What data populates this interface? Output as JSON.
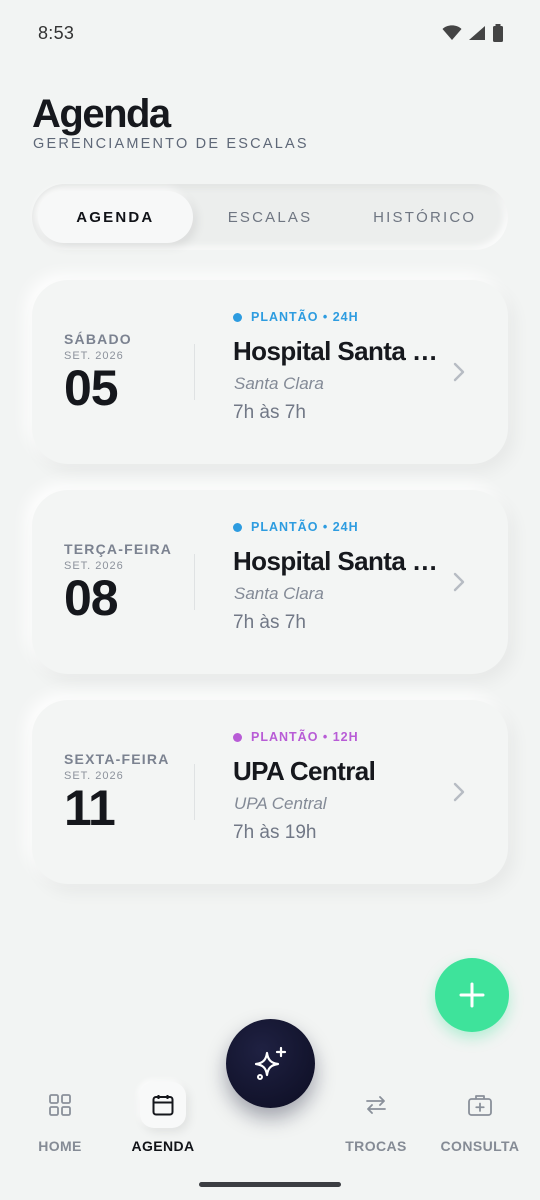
{
  "status": {
    "time": "8:53"
  },
  "header": {
    "title": "Agenda",
    "subtitle": "GERENCIAMENTO DE ESCALAS"
  },
  "tabs": [
    {
      "label": "AGENDA",
      "active": true
    },
    {
      "label": "ESCALAS",
      "active": false
    },
    {
      "label": "HISTÓRICO",
      "active": false
    }
  ],
  "cards": [
    {
      "weekday": "SÁBADO",
      "month": "SET. 2026",
      "day": "05",
      "shift": "PLANTÃO • 24H",
      "shift_color": "#2d9ce0",
      "place": "Hospital Santa Clara",
      "unit": "Santa Clara",
      "hours": "7h às 7h"
    },
    {
      "weekday": "TERÇA-FEIRA",
      "month": "SET. 2026",
      "day": "08",
      "shift": "PLANTÃO • 24H",
      "shift_color": "#2d9ce0",
      "place": "Hospital Santa Clara",
      "unit": "Santa Clara",
      "hours": "7h às 7h"
    },
    {
      "weekday": "SEXTA-FEIRA",
      "month": "SET. 2026",
      "day": "11",
      "shift": "PLANTÃO • 12H",
      "shift_color": "#b85cd6",
      "place": "UPA Central",
      "unit": "UPA Central",
      "hours": "7h às 19h"
    }
  ],
  "nav": [
    {
      "label": "HOME",
      "icon": "grid-icon",
      "active": false
    },
    {
      "label": "AGENDA",
      "icon": "calendar-icon",
      "active": true
    },
    {
      "label": "TROCAS",
      "icon": "swap-arrows-icon",
      "active": false
    },
    {
      "label": "CONSULTA",
      "icon": "medical-kit-icon",
      "active": false
    }
  ],
  "fabs": {
    "add_icon": "plus-icon",
    "magic_icon": "sparkles-icon"
  },
  "colors": {
    "accent_green": "#3ee39b",
    "dark_navy": "#0c0d22",
    "background": "#f2f4f3"
  }
}
